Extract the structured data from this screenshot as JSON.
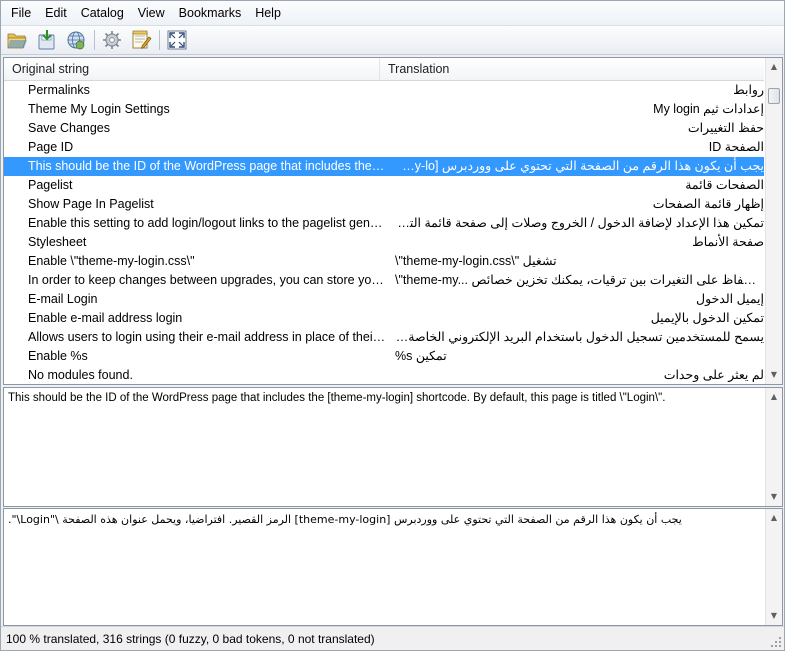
{
  "menu": {
    "items": [
      "File",
      "Edit",
      "Catalog",
      "View",
      "Bookmarks",
      "Help"
    ]
  },
  "toolbar": {
    "buttons": [
      "open-icon",
      "save-icon",
      "update-icon",
      "validate-icon",
      "edit-comment-icon",
      "fullscreen-icon"
    ]
  },
  "list": {
    "headers": {
      "original": "Original string",
      "translation": "Translation"
    },
    "selected_index": 4,
    "rows": [
      {
        "original": "Permalinks",
        "translation": "روابط"
      },
      {
        "original": "Theme My Login Settings",
        "translation": "إعدادات ثيم My login"
      },
      {
        "original": "Save Changes",
        "translation": "حفظ التغييرات"
      },
      {
        "original": "Page ID",
        "translation": "الصفحة ID"
      },
      {
        "original": "This should be the ID of the WordPress page that includes the [th...",
        "translation": "يجب أن يكون هذا الرقم من الصفحة التي تحتوي على ووردبرس [theme-my-lo..."
      },
      {
        "original": "Pagelist",
        "translation": "الصفحات قائمة"
      },
      {
        "original": "Show Page In Pagelist",
        "translation": "إظهار قائمة الصفحات"
      },
      {
        "original": "Enable this setting to add login/logout links to the pagelist gener...",
        "translation": "تمكين هذا الإعداد لإضافة الدخول / الخروج وصلات إلى صفحة قائمة التي تولدها و..."
      },
      {
        "original": "Stylesheet",
        "translation": "صفحة الأنماط"
      },
      {
        "original": "Enable \\\"theme-my-login.css\\\"",
        "translation": "\\\"theme-my-login.css\\\" تشغيل"
      },
      {
        "original": "In order to keep changes between upgrades, you can store your c...",
        "translation": "\\\"theme-my... من اجل الحفاظ على التغيرات بين ترقيات، يمكنك تخزين خصائص"
      },
      {
        "original": "E-mail Login",
        "translation": "إيميل الدخول"
      },
      {
        "original": "Enable e-mail address login",
        "translation": "تمكين الدخول بالإيميل"
      },
      {
        "original": "Allows users to login using their e-mail address in place of their u...",
        "translation": "يسمح للمستخدمين تسجيل الدخول باستخدام البريد الإلكتروني الخاصة بهم في م..."
      },
      {
        "original": "Enable %s",
        "translation": "%s تمكين"
      },
      {
        "original": "No modules found.",
        "translation": "لم يعثر على وحدات"
      }
    ]
  },
  "source_text": "This should be the ID of the WordPress page that includes the [theme-my-login] shortcode. By default, this page is titled \\\"Login\\\".",
  "translation_text": "يجب أن يكون هذا الرقم من الصفحة التي تحتوي على ووردبرس  [theme-my-login]  الرمز القصير. افتراضيا، ويحمل عنوان هذه الصفحة \\\"Login\\\".",
  "status": "100 % translated, 316 strings (0 fuzzy, 0 bad tokens, 0 not translated)",
  "colors": {
    "selection": "#3399ff",
    "window_bg": "#f0f0f0"
  }
}
